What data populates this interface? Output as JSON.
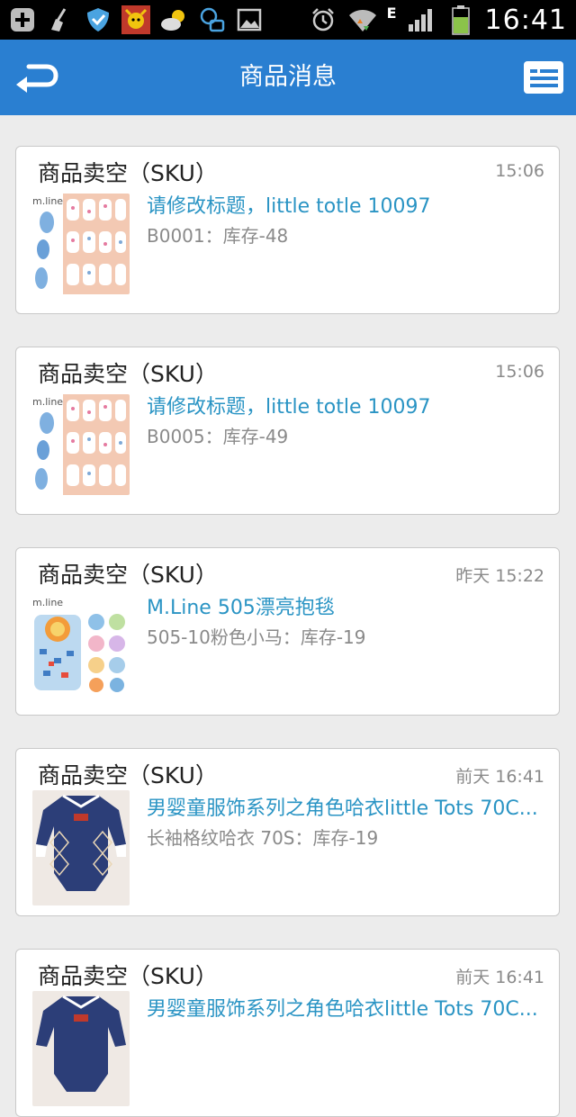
{
  "status_bar": {
    "time": "16:41",
    "network_label": "E",
    "left_icons": [
      "add-notification-icon",
      "broom-icon",
      "shield-icon",
      "avatar-app-icon",
      "weather-icon",
      "chat-bubble-icon",
      "image-icon"
    ],
    "right_icons": [
      "alarm-icon",
      "wifi-icon",
      "signal-icon",
      "battery-icon"
    ]
  },
  "header": {
    "title": "商品消息",
    "background": "#2a7fd1",
    "back_icon": "back-arrow-icon",
    "menu_icon": "list-icon"
  },
  "cards": [
    {
      "title": "商品卖空（SKU）",
      "time": "15:06",
      "product": "请修改标题，little totle 10097",
      "detail": "B0001：库存-48",
      "thumb": "swaddle"
    },
    {
      "title": "商品卖空（SKU）",
      "time": "15:06",
      "product": "请修改标题，little totle 10097",
      "detail": "B0005：库存-49",
      "thumb": "swaddle"
    },
    {
      "title": "商品卖空（SKU）",
      "time": "昨天 15:22",
      "product": "M.Line 505漂亮抱毯",
      "detail": "505-10粉色小马：库存-19",
      "thumb": "blanket"
    },
    {
      "title": "商品卖空（SKU）",
      "time": "前天 16:41",
      "product": "男婴童服饰系列之角色哈衣little Tots 70C...",
      "detail": "长袖格纹哈衣 70S：库存-19",
      "thumb": "onesie"
    },
    {
      "title": "商品卖空（SKU）",
      "time": "前天 16:41",
      "product": "男婴童服饰系列之角色哈衣little Tots 70C...",
      "detail": "",
      "thumb": "onesie"
    }
  ],
  "colors": {
    "accent_text": "#2a94c4",
    "muted_text": "#8a8a8a",
    "page_bg": "#ececec"
  }
}
